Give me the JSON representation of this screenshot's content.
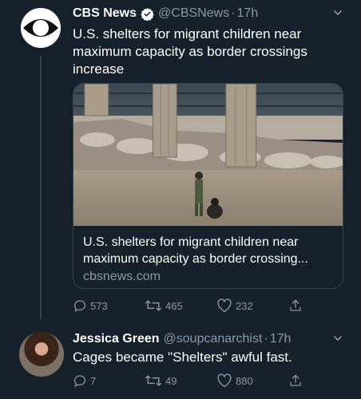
{
  "colors": {
    "background": "#15202b",
    "secondary_text": "#8899a6",
    "verified": "#ffffff",
    "divider": "#38444d"
  },
  "tweet": {
    "display_name": "CBS News",
    "handle": "@CBSNews",
    "separator": "·",
    "time": "17h",
    "verified_icon": "verified-badge-icon",
    "text": "U.S. shelters for migrant children near maximum capacity as border crossings increase",
    "card": {
      "title": "U.S. shelters for migrant children near maximum capacity as border crossing...",
      "domain": "cbsnews.com"
    },
    "actions": {
      "replies": "573",
      "retweets": "465",
      "likes": "232"
    }
  },
  "reply": {
    "display_name": "Jessica Green",
    "handle": "@soupcanarchist",
    "separator": "·",
    "time": "17h",
    "text": "Cages became \"Shelters\" awful fast.",
    "actions": {
      "replies": "7",
      "retweets": "49",
      "likes": "880"
    }
  }
}
